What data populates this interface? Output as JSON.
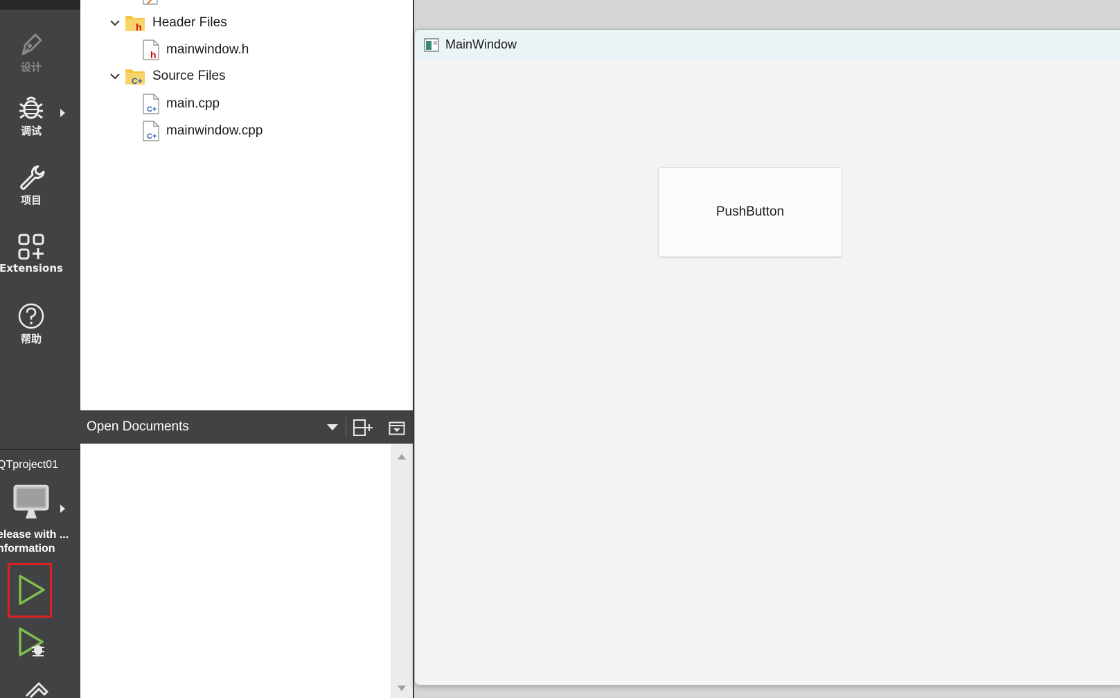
{
  "sidebar": {
    "modes": [
      {
        "label": "设计",
        "icon": "pen-icon"
      },
      {
        "label": "调试",
        "icon": "bug-icon"
      },
      {
        "label": "项目",
        "icon": "wrench-icon"
      },
      {
        "label": "Extensions",
        "icon": "extensions-icon"
      },
      {
        "label": "帮助",
        "icon": "help-icon"
      }
    ],
    "kit": {
      "project": "QTproject01",
      "build_line1": "elease with ...",
      "build_line2": "nformation"
    }
  },
  "project_tree": [
    {
      "label": "Header Files",
      "type": "folder",
      "icon": "header-folder-icon"
    },
    {
      "label": "mainwindow.h",
      "type": "file",
      "icon": "header-file-icon"
    },
    {
      "label": "Source Files",
      "type": "folder",
      "icon": "source-folder-icon"
    },
    {
      "label": "main.cpp",
      "type": "file",
      "icon": "cpp-file-icon"
    },
    {
      "label": "mainwindow.cpp",
      "type": "file",
      "icon": "cpp-file-icon"
    }
  ],
  "open_documents": {
    "title": "Open Documents"
  },
  "app_window": {
    "title": "MainWindow",
    "button_label": "PushButton"
  },
  "colors": {
    "sidebar_bg": "#404244",
    "highlight_border": "#e02020",
    "run_green": "#7fbf4d",
    "titlebar_bg": "#eaf4f6"
  }
}
